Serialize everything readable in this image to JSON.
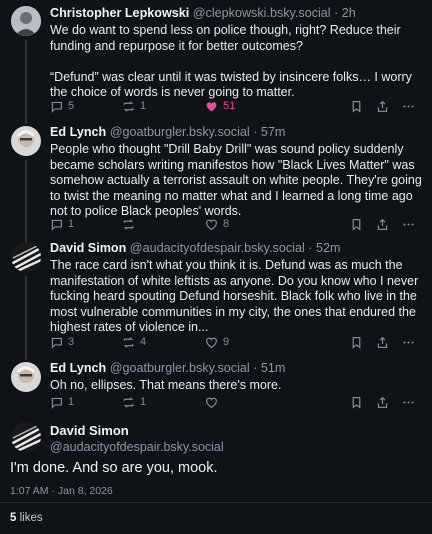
{
  "colors": {
    "background": "#0f1318",
    "like_accent": "#ec4899",
    "muted": "#7d8a99"
  },
  "posts": [
    {
      "author": "Christopher Lepkowski",
      "handle": "@clepkowski.bsky.social",
      "time": "· 2h",
      "text_lines": [
        "We do want to spend less on police though, right? Reduce their funding and repurpose it for better outcomes?",
        "",
        "“Defund” was clear until it was twisted by insincere folks… I worry the choice of words is never going to matter."
      ],
      "text": "We do want to spend less on police though, right? Reduce their funding and repurpose it for better outcomes?\n\n“Defund” was clear until it was twisted by insincere folks… I worry the choice of words is never going to matter.",
      "replies": "5",
      "reposts": "1",
      "likes": "51",
      "liked": true
    },
    {
      "author": "Ed Lynch",
      "handle": "@goatburgler.bsky.social",
      "time": "· 57m",
      "text": "People who thought \"Drill Baby Drill\" was sound policy suddenly became scholars writing manifestos how \"Black Lives Matter\" was somehow actually a terrorist assault on white people. They're going to twist the meaning no matter what and I learned a long time ago not to police Black peoples' words.",
      "replies": "1",
      "reposts": "",
      "likes": "8",
      "liked": false
    },
    {
      "author": "David Simon",
      "handle": "@audacityofdespair.bsky.social",
      "time": "· 52m",
      "text": "The race card isn't what you think it is. Defund was as much the manifestation of white leftists as anyone. Do you know who I never fucking heard spouting Defund horseshit. Black folk who live in the most vulnerable communities in my city, the ones that endured the highest rates of violence in...",
      "replies": "3",
      "reposts": "4",
      "likes": "9",
      "liked": false
    },
    {
      "author": "Ed Lynch",
      "handle": "@goatburgler.bsky.social",
      "time": "· 51m",
      "text": "Oh no, ellipses. That means there's more.",
      "replies": "1",
      "reposts": "1",
      "likes": "",
      "liked": false
    }
  ],
  "main_post": {
    "author": "David Simon",
    "handle": "@audacityofdespair.bsky.social",
    "text": "I'm done. And so are you, mook.",
    "timestamp": "1:07 AM · Jan 8, 2026",
    "like_count": "5",
    "like_label": "likes"
  }
}
